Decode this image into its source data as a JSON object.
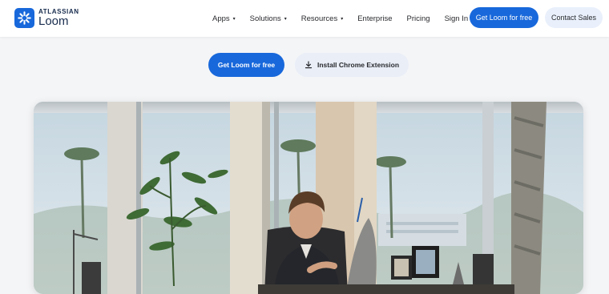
{
  "brand": {
    "top": "ATLASSIAN",
    "name": "Loom",
    "color": "#1868db"
  },
  "nav": {
    "items": [
      {
        "label": "Apps",
        "has_dropdown": true
      },
      {
        "label": "Solutions",
        "has_dropdown": true
      },
      {
        "label": "Resources",
        "has_dropdown": true
      },
      {
        "label": "Enterprise",
        "has_dropdown": false
      },
      {
        "label": "Pricing",
        "has_dropdown": false
      },
      {
        "label": "Sign In",
        "has_dropdown": false
      }
    ],
    "primary_button": "Get Loom for free",
    "secondary_button": "Contact Sales",
    "dropdown_glyph": "▾"
  },
  "hero": {
    "primary_cta": "Get Loom for free",
    "secondary_cta": "Install Chrome Extension",
    "secondary_cta_icon": "download-icon"
  },
  "media": {
    "icon": "video-thumbnail"
  }
}
